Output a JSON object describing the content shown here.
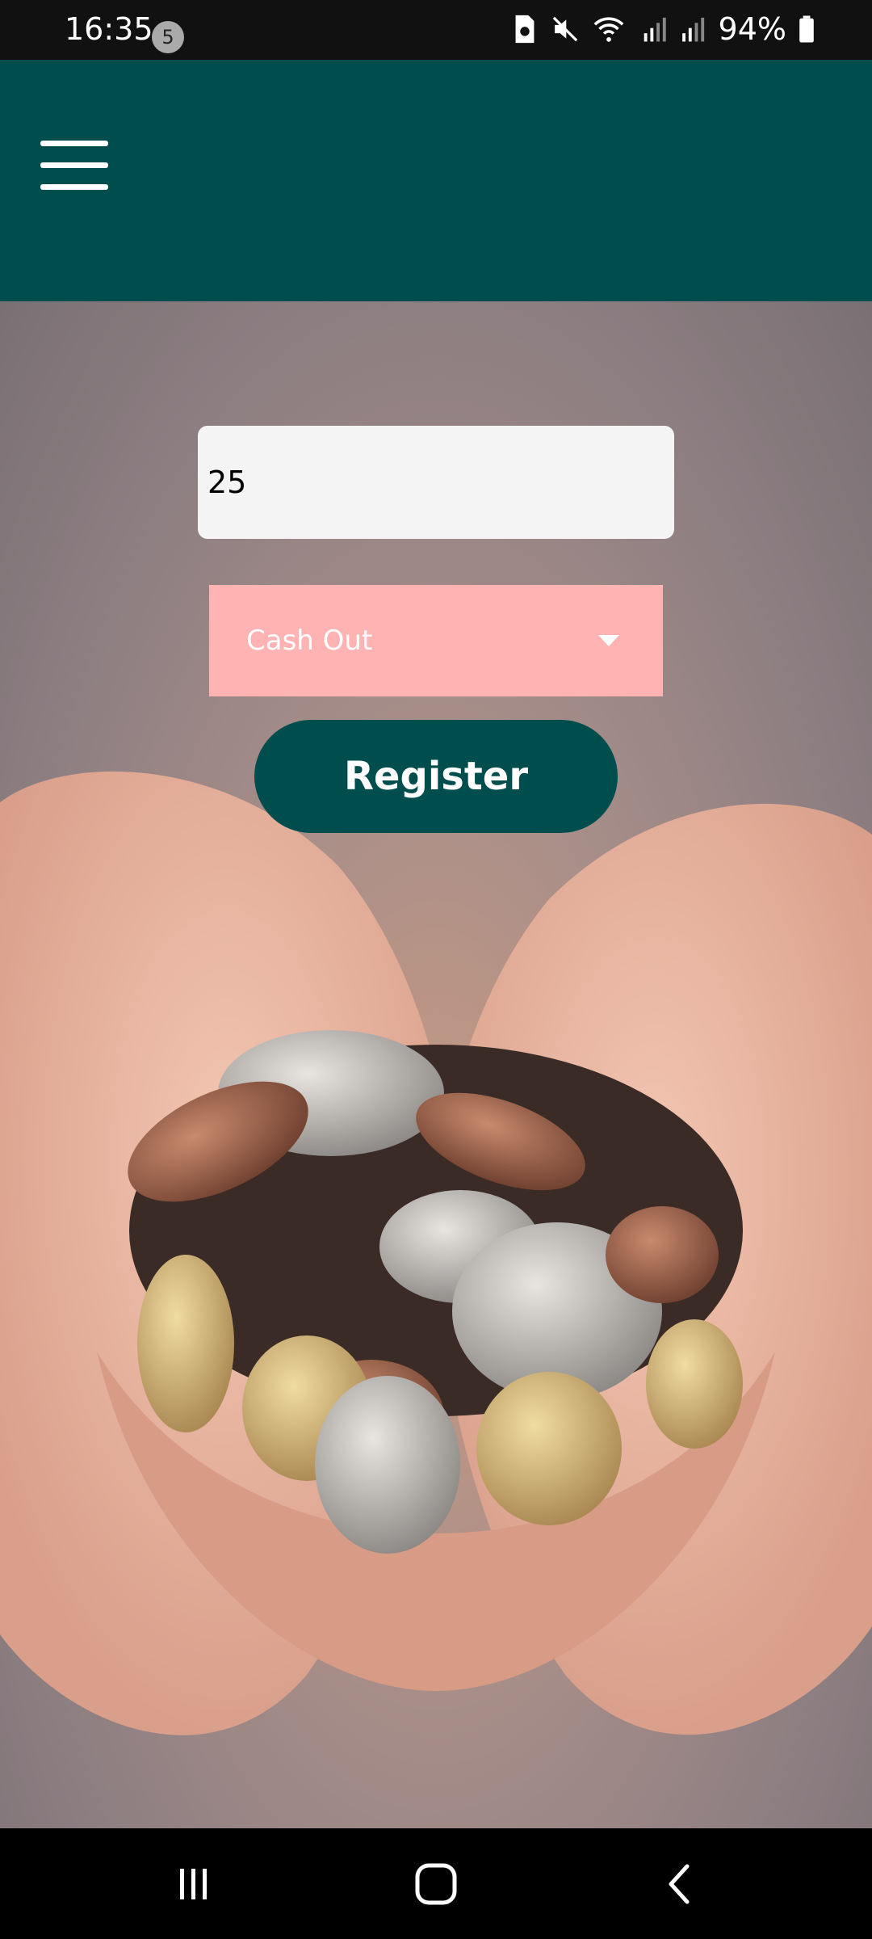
{
  "status_bar": {
    "time": "16:35",
    "notification_count": "5",
    "battery": "94%"
  },
  "app_bar": {
    "menu_icon": "hamburger-menu-icon"
  },
  "form": {
    "amount_value": "25",
    "transaction_type": "Cash Out",
    "register_label": "Register"
  },
  "nav_bar": {
    "recents_icon": "recents-icon",
    "home_icon": "home-icon",
    "back_icon": "back-icon"
  },
  "colors": {
    "app_bar": "#004d4d",
    "select_bg": "#ffb3b3",
    "button_bg": "#004d4d"
  }
}
